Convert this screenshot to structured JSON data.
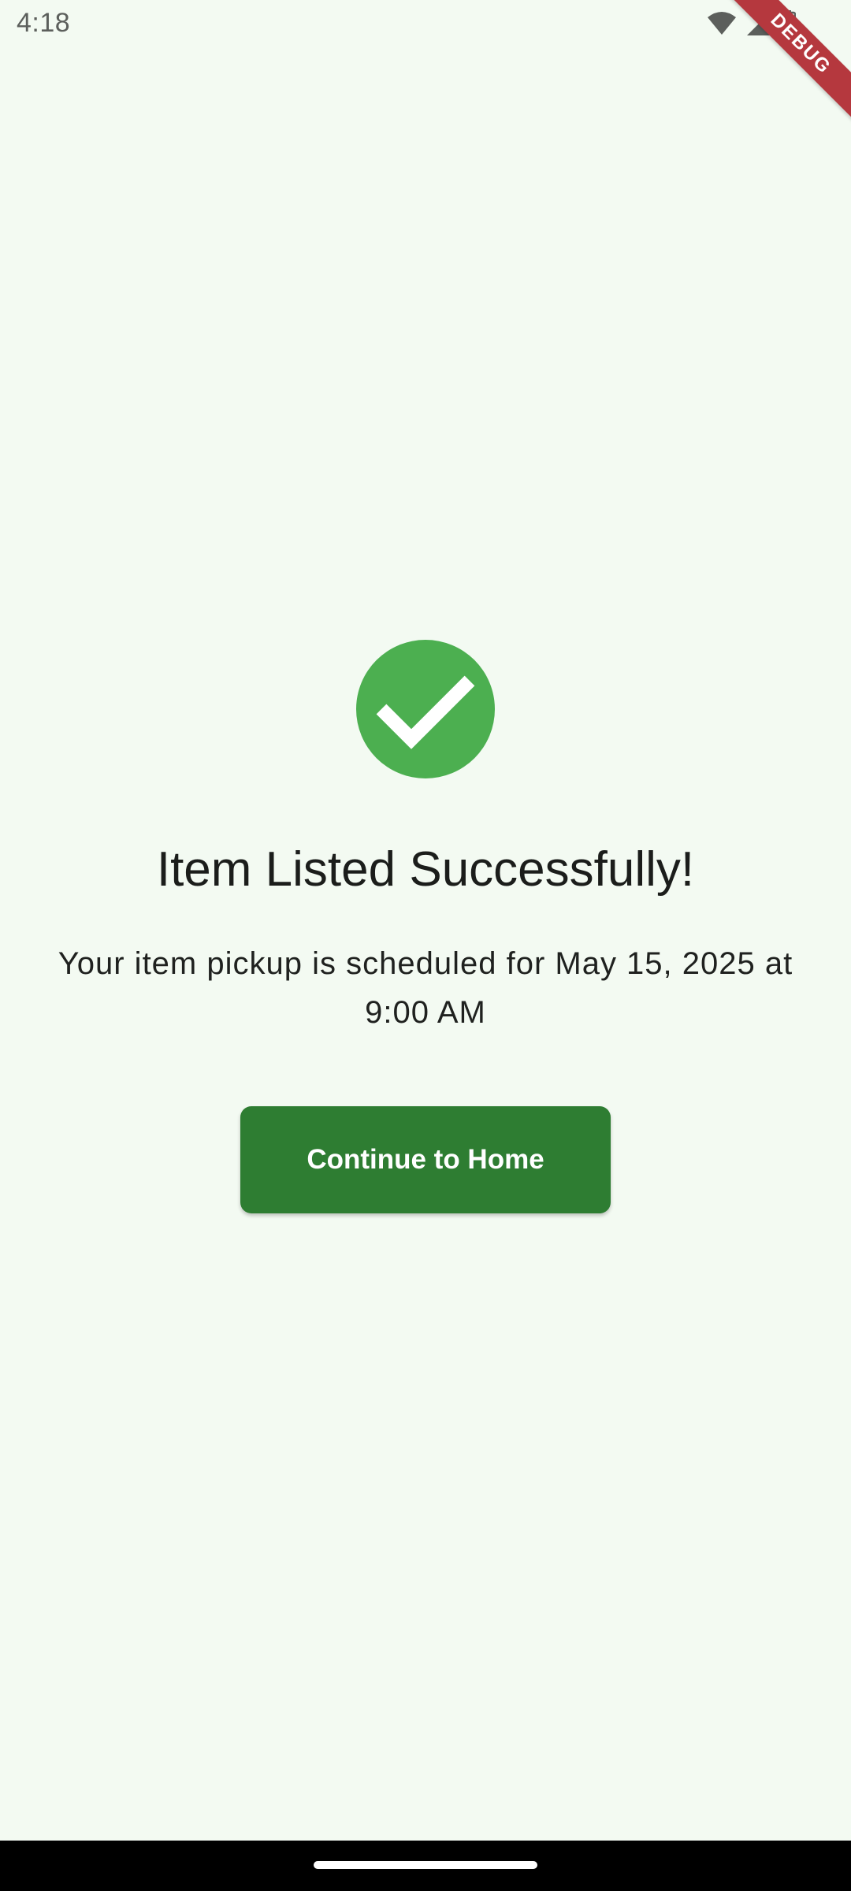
{
  "status_bar": {
    "time": "4:18",
    "icons": [
      "wifi-icon",
      "signal-icon",
      "battery-icon"
    ]
  },
  "debug_banner": {
    "label": "DEBUG",
    "color": "#b5383e"
  },
  "success": {
    "icon": "check-circle-icon",
    "icon_color": "#4caf50",
    "title": "Item Listed Successfully!",
    "message": "Your item pickup is scheduled for May 15, 2025 at 9:00 AM"
  },
  "actions": {
    "continue_label": "Continue to Home",
    "button_color": "#2e7d32"
  },
  "theme": {
    "background": "#f3faf2"
  }
}
